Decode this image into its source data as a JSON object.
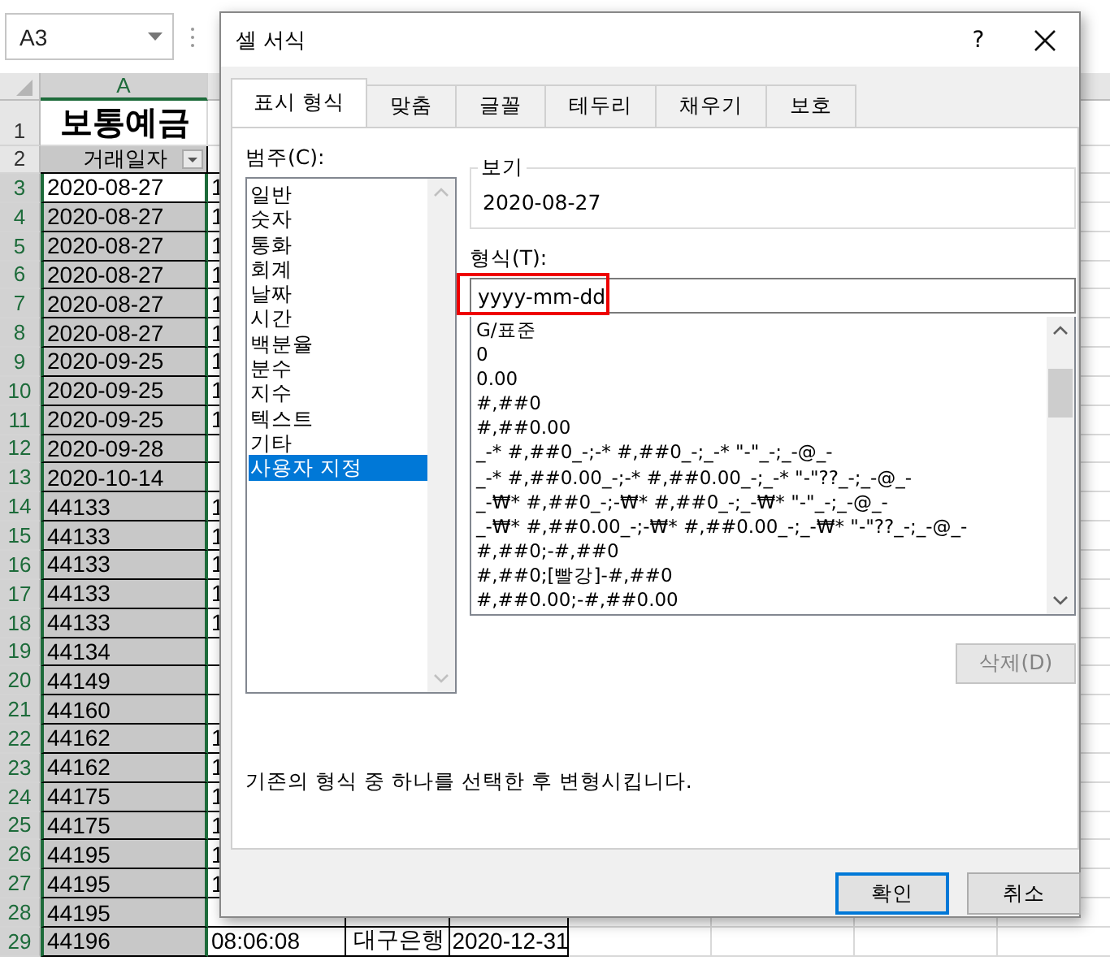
{
  "sheet": {
    "name_box": "A3",
    "columns": [
      {
        "label": "A",
        "selected": true
      }
    ],
    "rows": [
      {
        "num": "1",
        "kind": "title",
        "a": "보통예금",
        "selected": false
      },
      {
        "num": "2",
        "kind": "header",
        "a": "거래일자",
        "selected": false
      },
      {
        "num": "3",
        "kind": "data",
        "a": "2020-08-27",
        "b": "1",
        "selected": true,
        "active": true
      },
      {
        "num": "4",
        "kind": "data",
        "a": "2020-08-27",
        "b": "1",
        "selected": true,
        "active": false
      },
      {
        "num": "5",
        "kind": "data",
        "a": "2020-08-27",
        "b": "1",
        "selected": true,
        "active": false
      },
      {
        "num": "6",
        "kind": "data",
        "a": "2020-08-27",
        "b": "1",
        "selected": true,
        "active": false
      },
      {
        "num": "7",
        "kind": "data",
        "a": "2020-08-27",
        "b": "1",
        "selected": true,
        "active": false
      },
      {
        "num": "8",
        "kind": "data",
        "a": "2020-08-27",
        "b": "1",
        "selected": true,
        "active": false
      },
      {
        "num": "9",
        "kind": "data",
        "a": "2020-09-25",
        "b": "1",
        "selected": true,
        "active": false
      },
      {
        "num": "10",
        "kind": "data",
        "a": "2020-09-25",
        "b": "1",
        "selected": true,
        "active": false
      },
      {
        "num": "11",
        "kind": "data",
        "a": "2020-09-25",
        "b": "1",
        "selected": true,
        "active": false
      },
      {
        "num": "12",
        "kind": "data",
        "a": "2020-09-28",
        "selected": true,
        "active": false
      },
      {
        "num": "13",
        "kind": "data",
        "a": "2020-10-14",
        "selected": true,
        "active": false
      },
      {
        "num": "14",
        "kind": "data",
        "a": "44133",
        "b": "1",
        "selected": true,
        "active": false
      },
      {
        "num": "15",
        "kind": "data",
        "a": "44133",
        "b": "1",
        "selected": true,
        "active": false
      },
      {
        "num": "16",
        "kind": "data",
        "a": "44133",
        "b": "1",
        "selected": true,
        "active": false
      },
      {
        "num": "17",
        "kind": "data",
        "a": "44133",
        "b": "1",
        "selected": true,
        "active": false
      },
      {
        "num": "18",
        "kind": "data",
        "a": "44133",
        "b": "1",
        "selected": true,
        "active": false
      },
      {
        "num": "19",
        "kind": "data",
        "a": "44134",
        "selected": true,
        "active": false
      },
      {
        "num": "20",
        "kind": "data",
        "a": "44149",
        "selected": true,
        "active": false
      },
      {
        "num": "21",
        "kind": "data",
        "a": "44160",
        "selected": true,
        "active": false
      },
      {
        "num": "22",
        "kind": "data",
        "a": "44162",
        "b": "1",
        "selected": true,
        "active": false
      },
      {
        "num": "23",
        "kind": "data",
        "a": "44162",
        "b": "1",
        "selected": true,
        "active": false
      },
      {
        "num": "24",
        "kind": "data",
        "a": "44175",
        "b": "1",
        "selected": true,
        "active": false
      },
      {
        "num": "25",
        "kind": "data",
        "a": "44175",
        "b": "1",
        "selected": true,
        "active": false
      },
      {
        "num": "26",
        "kind": "data",
        "a": "44195",
        "b": "1",
        "selected": true,
        "active": false
      },
      {
        "num": "27",
        "kind": "data",
        "a": "44195",
        "b": "1",
        "selected": true,
        "active": false
      },
      {
        "num": "28",
        "kind": "data",
        "a": "44195",
        "selected": true,
        "active": false
      },
      {
        "num": "29",
        "kind": "data",
        "a": "44196",
        "b": "08:06:08",
        "c": "대구은행",
        "d": "2020-12-31",
        "selected": true,
        "active": false
      }
    ]
  },
  "dialog": {
    "title": "셀 서식",
    "help": "?",
    "tabs": [
      {
        "label": "표시 형식",
        "selected": true
      },
      {
        "label": "맞춤",
        "selected": false
      },
      {
        "label": "글꼴",
        "selected": false
      },
      {
        "label": "테두리",
        "selected": false
      },
      {
        "label": "채우기",
        "selected": false
      },
      {
        "label": "보호",
        "selected": false
      }
    ],
    "category_label": "범주(C):",
    "categories": [
      {
        "label": "일반",
        "selected": false
      },
      {
        "label": "숫자",
        "selected": false
      },
      {
        "label": "통화",
        "selected": false
      },
      {
        "label": "회계",
        "selected": false
      },
      {
        "label": "날짜",
        "selected": false
      },
      {
        "label": "시간",
        "selected": false
      },
      {
        "label": "백분율",
        "selected": false
      },
      {
        "label": "분수",
        "selected": false
      },
      {
        "label": "지수",
        "selected": false
      },
      {
        "label": "텍스트",
        "selected": false
      },
      {
        "label": "기타",
        "selected": false
      },
      {
        "label": "사용자 지정",
        "selected": true
      }
    ],
    "sample": {
      "label": "보기",
      "value": "2020-08-27"
    },
    "format_label": "형식(T):",
    "format_input": {
      "value": "yyyy-mm-dd",
      "highlighted": true
    },
    "formats": [
      "G/표준",
      "0",
      "0.00",
      "#,##0",
      "#,##0.00",
      "_-* #,##0_-;-* #,##0_-;_-* \"-\"_-;_-@_-",
      "_-* #,##0.00_-;-* #,##0.00_-;_-* \"-\"??_-;_-@_-",
      "_-₩* #,##0_-;-₩* #,##0_-;_-₩* \"-\"_-;_-@_-",
      "_-₩* #,##0.00_-;-₩* #,##0.00_-;_-₩* \"-\"??_-;_-@_-",
      "#,##0;-#,##0",
      "#,##0;[빨강]-#,##0",
      "#,##0.00;-#,##0.00"
    ],
    "delete_button": {
      "label": "삭제(D)",
      "disabled": true
    },
    "description": "기존의 형식 중 하나를 선택한 후 변형시킵니다.",
    "buttons": [
      {
        "label": "확인",
        "default": true
      },
      {
        "label": "취소",
        "default": false
      }
    ]
  }
}
